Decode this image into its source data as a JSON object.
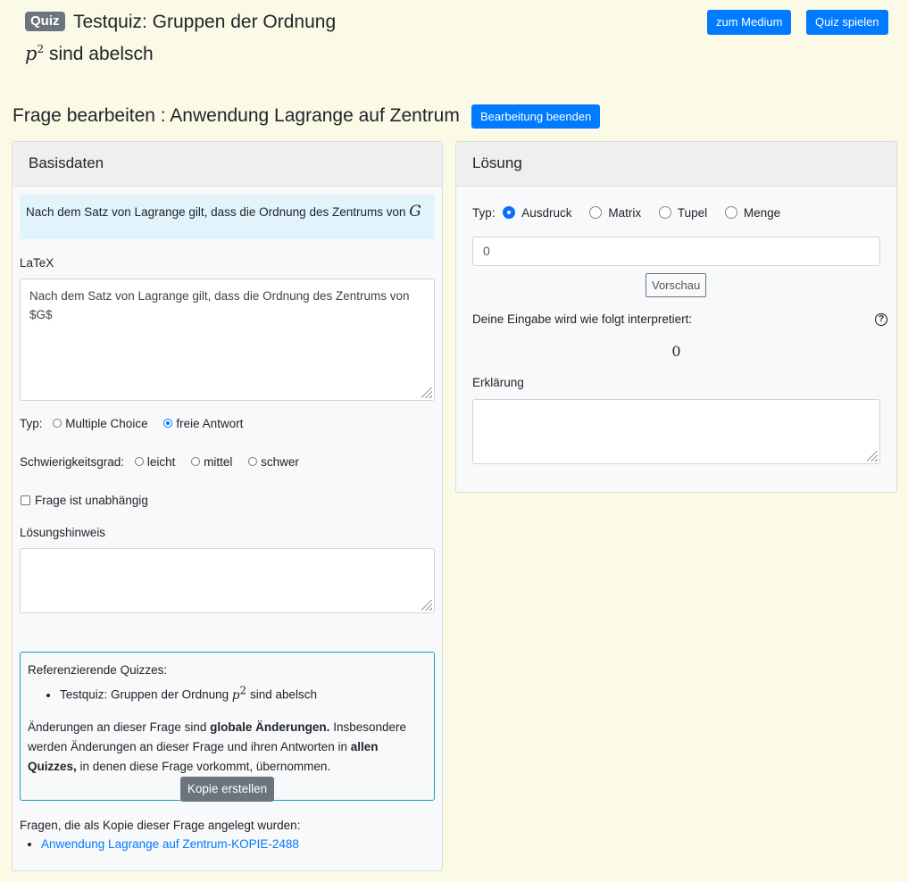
{
  "header": {
    "badge": "Quiz",
    "quiz_title_prefix": "Testquiz: Gruppen der Ordnung",
    "math_var": "p",
    "math_exp": "2",
    "quiz_title_suffix": "sind abelsch",
    "btn_medium": "zum Medium",
    "btn_play": "Quiz spielen"
  },
  "page": {
    "heading": "Frage bearbeiten : Anwendung Lagrange auf Zentrum",
    "btn_end": "Bearbeitung beenden"
  },
  "basis": {
    "title": "Basisdaten",
    "preview_text": "Nach dem Satz von Lagrange gilt, dass die Ordnung des Zentrums von",
    "preview_math": "G",
    "latex_label": "LaTeX",
    "latex_line1": "Nach dem Satz von Lagrange gilt, dass die Ordnung des Zentrums von",
    "latex_line2": "$G$",
    "type_label": "Typ:",
    "type_options": [
      "Multiple Choice",
      "freie Antwort"
    ],
    "type_selected": "freie Antwort",
    "difficulty_label": "Schwierigkeitsgrad:",
    "difficulty_options": [
      "leicht",
      "mittel",
      "schwer"
    ],
    "independent_label": "Frage ist unabhängig",
    "hint_label": "Lösungshinweis",
    "hint_value": ""
  },
  "references": {
    "heading": "Referenzierende Quizzes:",
    "item_prefix": "Testquiz: Gruppen der Ordnung",
    "item_var": "p",
    "item_exp": "2",
    "item_suffix": "sind abelsch",
    "warn_1": "Änderungen an dieser Frage sind",
    "warn_bold_1": "globale Änderungen.",
    "warn_2": "Insbesondere werden Änderungen an dieser Frage und ihren Antworten in",
    "warn_bold_2": "allen Quizzes,",
    "warn_3": "in denen diese Frage vorkommt, übernommen.",
    "copy_button": "Kopie erstellen"
  },
  "copies": {
    "heading": "Fragen, die als Kopie dieser Frage angelegt wurden:",
    "links": [
      "Anwendung Lagrange auf Zentrum-KOPIE-2488"
    ]
  },
  "solution": {
    "title": "Lösung",
    "type_label": "Typ:",
    "type_options": [
      "Ausdruck",
      "Matrix",
      "Tupel",
      "Menge"
    ],
    "type_selected": "Ausdruck",
    "input_value": "0",
    "preview_button": "Vorschau",
    "interpret_label": "Deine Eingabe wird wie folgt interpretiert:",
    "help_icon_glyph": "?",
    "interpreted_value": "0",
    "explanation_label": "Erklärung",
    "explanation_value": ""
  },
  "colors": {
    "page_bg": "#fafae6",
    "primary": "#007bff",
    "secondary": "#6c757d",
    "info_border": "#17a2b8",
    "preview_bg": "#e1f4fb"
  }
}
